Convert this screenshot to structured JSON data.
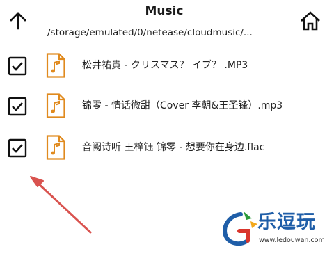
{
  "header": {
    "title": "Music",
    "path": "/storage/emulated/0/netease/cloudmusic/...",
    "back_icon": "arrow-up-icon",
    "home_icon": "home-icon"
  },
  "files": [
    {
      "name": "松井祐貴 - クリスマス？ イブ？ .MP3",
      "checked": true,
      "icon": "music-file-icon"
    },
    {
      "name": "锦零 - 情话微甜（Cover 李朝&王圣锋）.mp3",
      "checked": true,
      "icon": "music-file-icon"
    },
    {
      "name": "音阙诗听 王梓钰 锦零 - 想要你在身边.flac",
      "checked": true,
      "icon": "music-file-icon"
    }
  ],
  "watermark": {
    "name": "乐逗玩",
    "url": "www.ledouwan.com"
  },
  "colors": {
    "file_icon": "#e08a1e",
    "arrow": "#d9534f",
    "watermark_text": "#1f5ea8"
  }
}
